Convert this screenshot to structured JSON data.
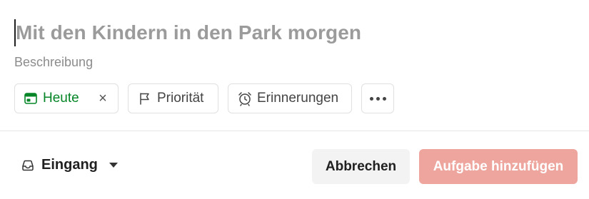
{
  "task": {
    "title_placeholder": "Mit den Kindern in den Park morgen",
    "description_placeholder": "Beschreibung"
  },
  "chips": {
    "date_label": "Heute",
    "date_clear": "×",
    "priority_label": "Priorität",
    "reminders_label": "Erinnerungen"
  },
  "footer": {
    "project_label": "Eingang",
    "cancel_label": "Abbrechen",
    "add_label": "Aufgabe hinzufügen"
  },
  "colors": {
    "accent_green": "#058527",
    "add_button": "#eda59e",
    "cancel_button": "#f3f3f3"
  },
  "icons": [
    "calendar-icon",
    "close-icon",
    "flag-icon",
    "alarm-clock-icon",
    "more-icon",
    "inbox-icon",
    "caret-down-icon"
  ]
}
